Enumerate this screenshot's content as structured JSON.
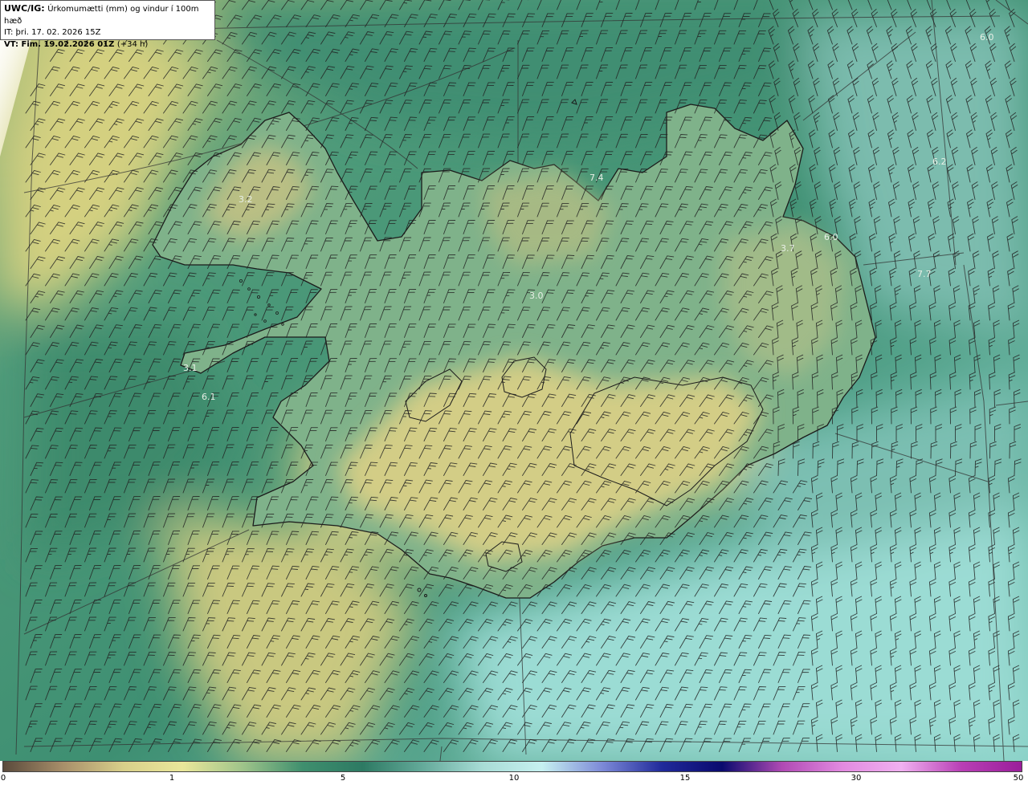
{
  "header": {
    "product": "UWC/IG:",
    "description": "Úrkomumætti (mm) og vindur í 100m hæð",
    "init_time": "IT: þri. 17. 02. 2026 15Z",
    "valid_label": "VT: Fim. 19.02.2026 01Z",
    "valid_offset": "(+34 h)"
  },
  "map_labels": [
    {
      "id": "ne-corner",
      "text": "6.0"
    },
    {
      "id": "east-sea",
      "text": "6.2"
    },
    {
      "id": "north-peninsula",
      "text": "7.4"
    },
    {
      "id": "westfjords",
      "text": "3.2"
    },
    {
      "id": "northeast",
      "text": "3.7"
    },
    {
      "id": "langanes",
      "text": "6.0"
    },
    {
      "id": "east-coast-sea",
      "text": "7.7"
    },
    {
      "id": "north-central",
      "text": "3.0"
    },
    {
      "id": "snaefellsnes",
      "text": "3.1"
    },
    {
      "id": "west-sea",
      "text": "6.1"
    }
  ],
  "colorbar": {
    "ticks": [
      "0",
      "1",
      "5",
      "10",
      "15",
      "30",
      "50"
    ],
    "colors": [
      "#5a4a3c",
      "#a88f6a",
      "#d8cf8a",
      "#eae79a",
      "#9fc48a",
      "#3f8f6e",
      "#2d7a63",
      "#64aa9a",
      "#a8dcd6",
      "#c6f0f0",
      "#7d8ad8",
      "#202a9a",
      "#0a0a6e",
      "#b04ab4",
      "#e28ae0",
      "#f0b0f0",
      "#b83fb5",
      "#9a1e9a"
    ]
  },
  "colors": {
    "land_outline": "#1b1b1b",
    "grid_line": "#333333",
    "barb": "#222222",
    "ocean_teal": "#4e9e8a",
    "low_precip": "#cfd07e",
    "high_precip_sea": "#8fd2c8"
  }
}
